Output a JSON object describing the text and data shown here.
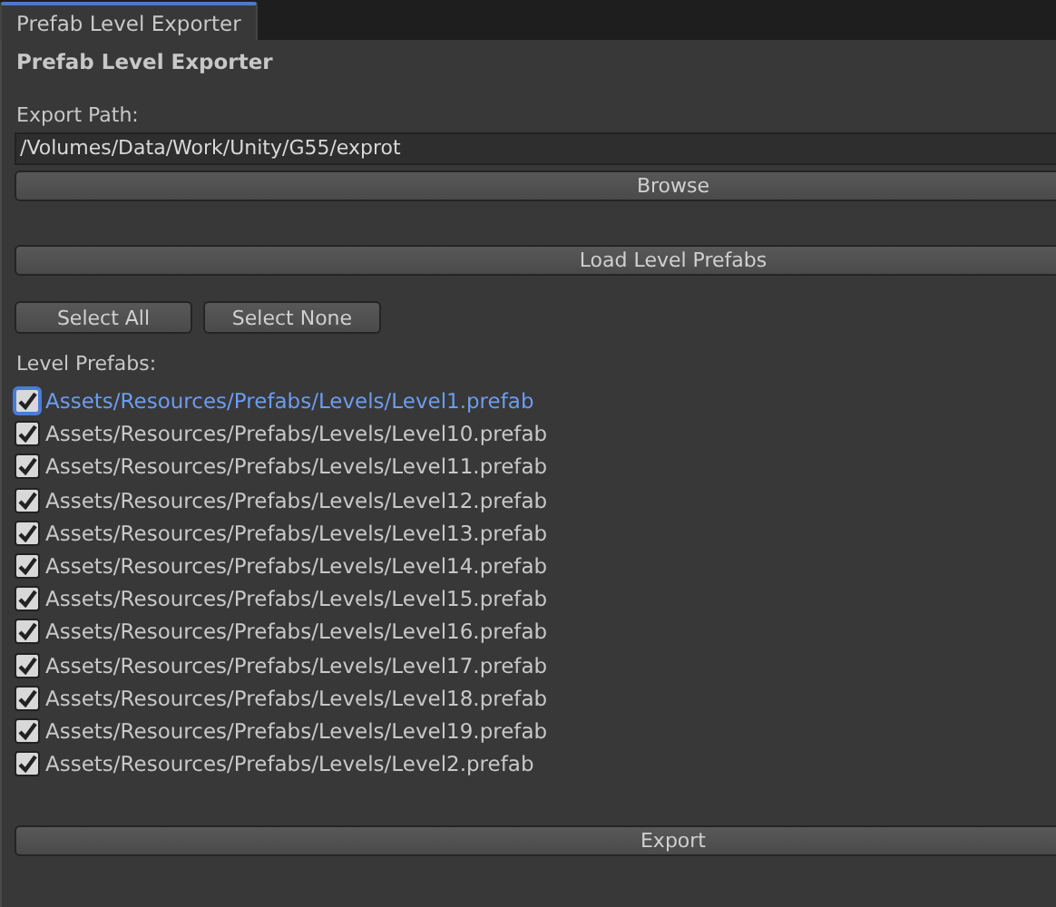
{
  "tab": {
    "label": "Prefab Level Exporter",
    "selected": true
  },
  "title": "Prefab Level Exporter",
  "export_path": {
    "label": "Export Path:",
    "value": "/Volumes/Data/Work/Unity/G55/exprot"
  },
  "browse_button": "Browse",
  "load_button": "Load Level Prefabs",
  "select_all_button": "Select All",
  "select_none_button": "Select None",
  "list_label": "Level Prefabs:",
  "prefabs": [
    {
      "label": "Assets/Resources/Prefabs/Levels/Level1.prefab",
      "checked": true,
      "selected": true
    },
    {
      "label": "Assets/Resources/Prefabs/Levels/Level10.prefab",
      "checked": true,
      "selected": false
    },
    {
      "label": "Assets/Resources/Prefabs/Levels/Level11.prefab",
      "checked": true,
      "selected": false
    },
    {
      "label": "Assets/Resources/Prefabs/Levels/Level12.prefab",
      "checked": true,
      "selected": false
    },
    {
      "label": "Assets/Resources/Prefabs/Levels/Level13.prefab",
      "checked": true,
      "selected": false
    },
    {
      "label": "Assets/Resources/Prefabs/Levels/Level14.prefab",
      "checked": true,
      "selected": false
    },
    {
      "label": "Assets/Resources/Prefabs/Levels/Level15.prefab",
      "checked": true,
      "selected": false
    },
    {
      "label": "Assets/Resources/Prefabs/Levels/Level16.prefab",
      "checked": true,
      "selected": false
    },
    {
      "label": "Assets/Resources/Prefabs/Levels/Level17.prefab",
      "checked": true,
      "selected": false
    },
    {
      "label": "Assets/Resources/Prefabs/Levels/Level18.prefab",
      "checked": true,
      "selected": false
    },
    {
      "label": "Assets/Resources/Prefabs/Levels/Level19.prefab",
      "checked": true,
      "selected": false
    },
    {
      "label": "Assets/Resources/Prefabs/Levels/Level2.prefab",
      "checked": true,
      "selected": false
    }
  ],
  "export_button": "Export"
}
